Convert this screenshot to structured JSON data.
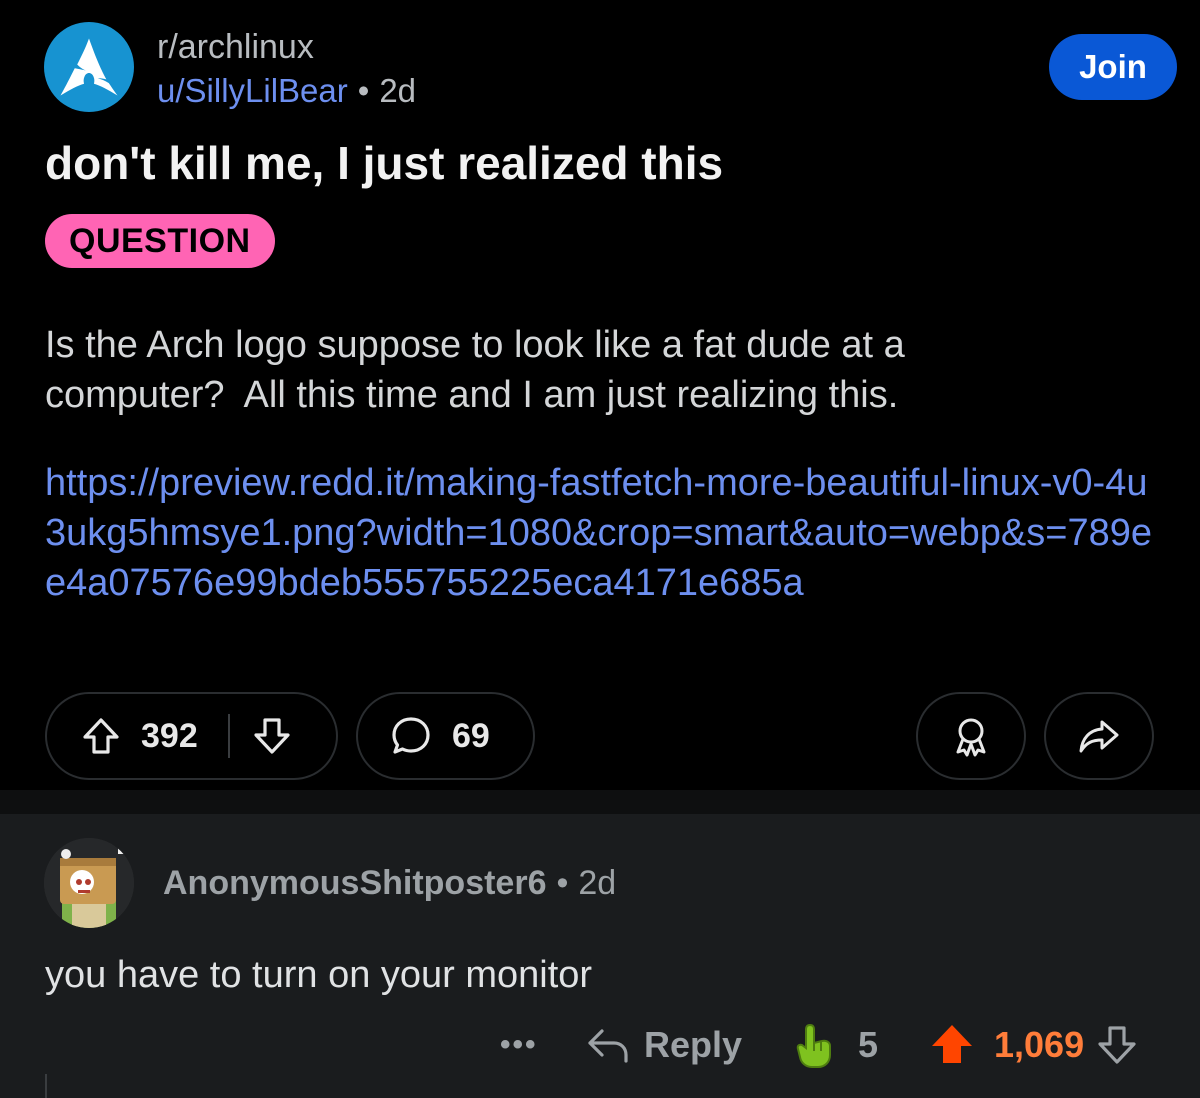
{
  "post": {
    "subreddit": "r/archlinux",
    "author": "u/SillyLilBear",
    "separator": "•",
    "age": "2d",
    "join_label": "Join",
    "title": "don't kill me, I just realized this",
    "flair": "QUESTION",
    "body": "Is the Arch logo suppose to look like a fat dude at a\ncomputer?  All this time and I am just realizing this.",
    "link": "https://preview.redd.it/making-fastfetch-more-beautiful-linux-v0-4u3ukg5hmsye1.png?width=1080&crop=smart&auto=webp&s=789ee4a07576e99bdeb555755225eca4171e685a",
    "votes": "392",
    "comments": "69",
    "icons": [
      "arch-logo",
      "upvote-icon",
      "downvote-icon",
      "comment-icon",
      "award-icon",
      "share-icon"
    ]
  },
  "comment": {
    "author": "AnonymousShitposter6",
    "separator": "•",
    "age": "2d",
    "text": "you have to turn on your monitor",
    "more": "•••",
    "reply_label": "Reply",
    "award_count": "5",
    "score": "1,069",
    "icons": [
      "more-icon",
      "reply-icon",
      "hand-pointing-award-icon",
      "upvote-filled-icon",
      "downvote-icon"
    ]
  },
  "colors": {
    "background": "#000000",
    "join_button": "#0a58d6",
    "flair": "#ff64b4",
    "link": "#6d8fef",
    "upvoted_score": "#ff7d3a",
    "comment_background": "#1a1c1e"
  }
}
